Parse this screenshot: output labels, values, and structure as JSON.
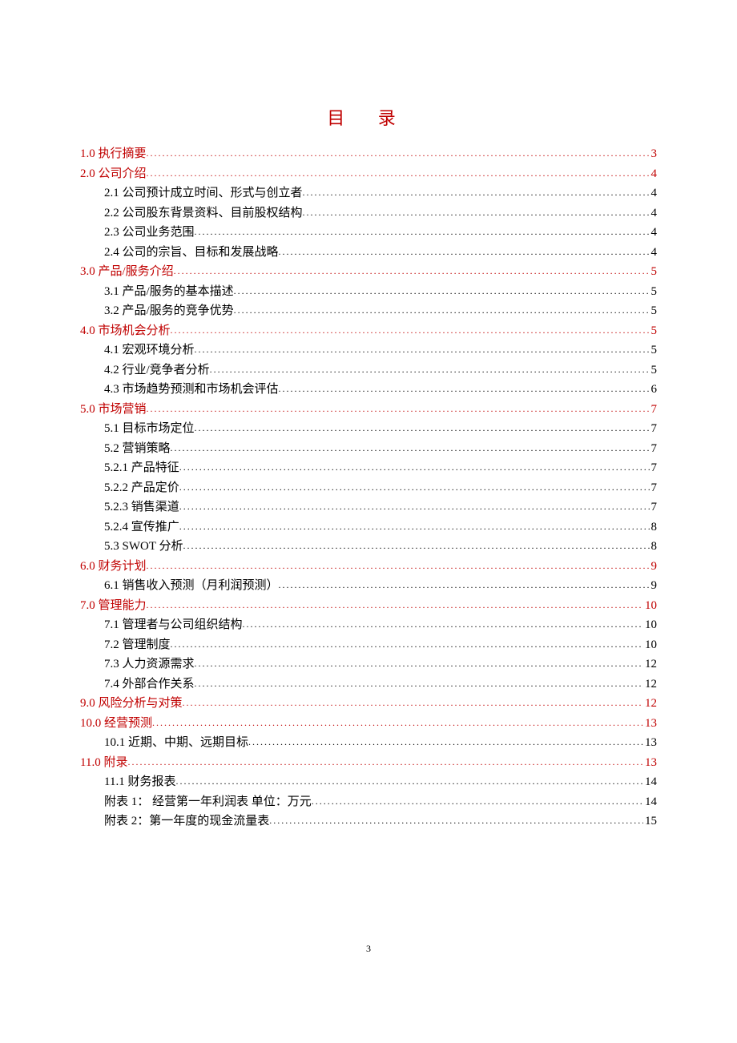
{
  "title": "目 录",
  "page_number": "3",
  "entries": [
    {
      "level": 1,
      "red": true,
      "label": "1.0 执行摘要",
      "page": "3"
    },
    {
      "level": 1,
      "red": true,
      "label": "2.0 公司介绍",
      "page": "4"
    },
    {
      "level": 2,
      "red": false,
      "label": "2.1 公司预计成立时间、形式与创立者",
      "page": "4"
    },
    {
      "level": 2,
      "red": false,
      "label": "2.2 公司股东背景资料、目前股权结构",
      "page": "4"
    },
    {
      "level": 2,
      "red": false,
      "label": "2.3 公司业务范围",
      "page": "4"
    },
    {
      "level": 2,
      "red": false,
      "label": "2.4 公司的宗旨、目标和发展战略",
      "page": "4"
    },
    {
      "level": 1,
      "red": true,
      "label": "3.0 产品/服务介绍",
      "page": "5"
    },
    {
      "level": 2,
      "red": false,
      "label": "3.1 产品/服务的基本描述",
      "page": "5"
    },
    {
      "level": 2,
      "red": false,
      "label": "3.2 产品/服务的竞争优势",
      "page": "5"
    },
    {
      "level": 1,
      "red": true,
      "label": "4.0 市场机会分析",
      "page": "5"
    },
    {
      "level": 2,
      "red": false,
      "label": "4.1 宏观环境分析",
      "page": "5"
    },
    {
      "level": 2,
      "red": false,
      "label": "4.2 行业/竞争者分析",
      "page": "5"
    },
    {
      "level": 2,
      "red": false,
      "label": "4.3 市场趋势预测和市场机会评估",
      "page": "6"
    },
    {
      "level": 1,
      "red": true,
      "label": "5.0 市场营销",
      "page": "7"
    },
    {
      "level": 2,
      "red": false,
      "label": "5.1 目标市场定位",
      "page": "7"
    },
    {
      "level": 2,
      "red": false,
      "label": "5.2 营销策略",
      "page": "7"
    },
    {
      "level": 2,
      "red": false,
      "label": "5.2.1 产品特征",
      "page": "7"
    },
    {
      "level": 2,
      "red": false,
      "label": "5.2.2 产品定价",
      "page": "7"
    },
    {
      "level": 2,
      "red": false,
      "label": "5.2.3 销售渠道",
      "page": "7"
    },
    {
      "level": 2,
      "red": false,
      "label": "5.2.4 宣传推广",
      "page": "8"
    },
    {
      "level": 2,
      "red": false,
      "label": "5.3 SWOT 分析",
      "page": "8"
    },
    {
      "level": 1,
      "red": true,
      "label": "6.0 财务计划",
      "page": "9"
    },
    {
      "level": 2,
      "red": false,
      "label": "6.1 销售收入预测（月利润预测）",
      "page": "9"
    },
    {
      "level": 1,
      "red": true,
      "label": "7.0 管理能力",
      "page": "10"
    },
    {
      "level": 2,
      "red": false,
      "label": "7.1 管理者与公司组织结构",
      "page": "10"
    },
    {
      "level": 2,
      "red": false,
      "label": "7.2 管理制度",
      "page": "10"
    },
    {
      "level": 2,
      "red": false,
      "label": "7.3 人力资源需求",
      "page": "12"
    },
    {
      "level": 2,
      "red": false,
      "label": "7.4 外部合作关系",
      "page": "12"
    },
    {
      "level": 1,
      "red": true,
      "label": "9.0  风险分析与对策",
      "page": "12"
    },
    {
      "level": 1,
      "red": true,
      "label": "10.0 经营预测",
      "page": "13"
    },
    {
      "level": 2,
      "red": false,
      "label": "10.1 近期、中期、远期目标",
      "page": "13"
    },
    {
      "level": 1,
      "red": true,
      "label": "11.0 附录",
      "page": "13"
    },
    {
      "level": 2,
      "red": false,
      "label": "11.1 财务报表",
      "page": "14"
    },
    {
      "level": 2,
      "red": false,
      "label": "附表 1： 经营第一年利润表                                                         单位：万元",
      "page": "14"
    },
    {
      "level": 2,
      "red": false,
      "label": "附表 2：第一年度的现金流量表",
      "page": "15"
    }
  ]
}
